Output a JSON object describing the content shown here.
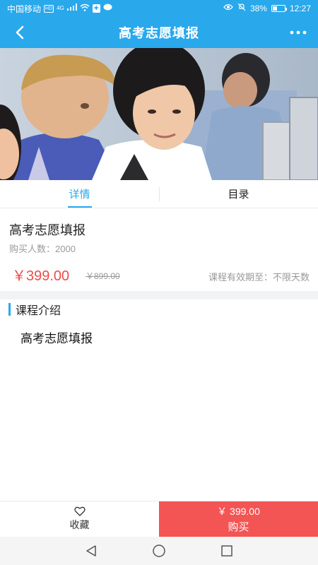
{
  "status_bar": {
    "carrier": "中国移动",
    "hd_badge": "HD",
    "network": "4G",
    "battery_percent": "38%",
    "battery_level": 0.38,
    "time": "12:27"
  },
  "header": {
    "title": "高考志愿填报",
    "back_icon": "chevron-left-icon",
    "more_icon": "more-horizontal-icon"
  },
  "tabs": [
    {
      "label": "详情",
      "active": true
    },
    {
      "label": "目录",
      "active": false
    }
  ],
  "course": {
    "title": "高考志愿填报",
    "buyers": "购买人数：2000",
    "price": "￥399.00",
    "original_price": "￥899.00",
    "validity": "课程有效期至：不限天数"
  },
  "intro": {
    "heading": "课程介绍",
    "content": "高考志愿填报"
  },
  "bottom_bar": {
    "favorite_label": "收藏",
    "buy_price": "￥ 399.00",
    "buy_label": "购买"
  },
  "colors": {
    "primary": "#29a8ec",
    "price": "#ee4b4b",
    "buy_button": "#f35454"
  }
}
